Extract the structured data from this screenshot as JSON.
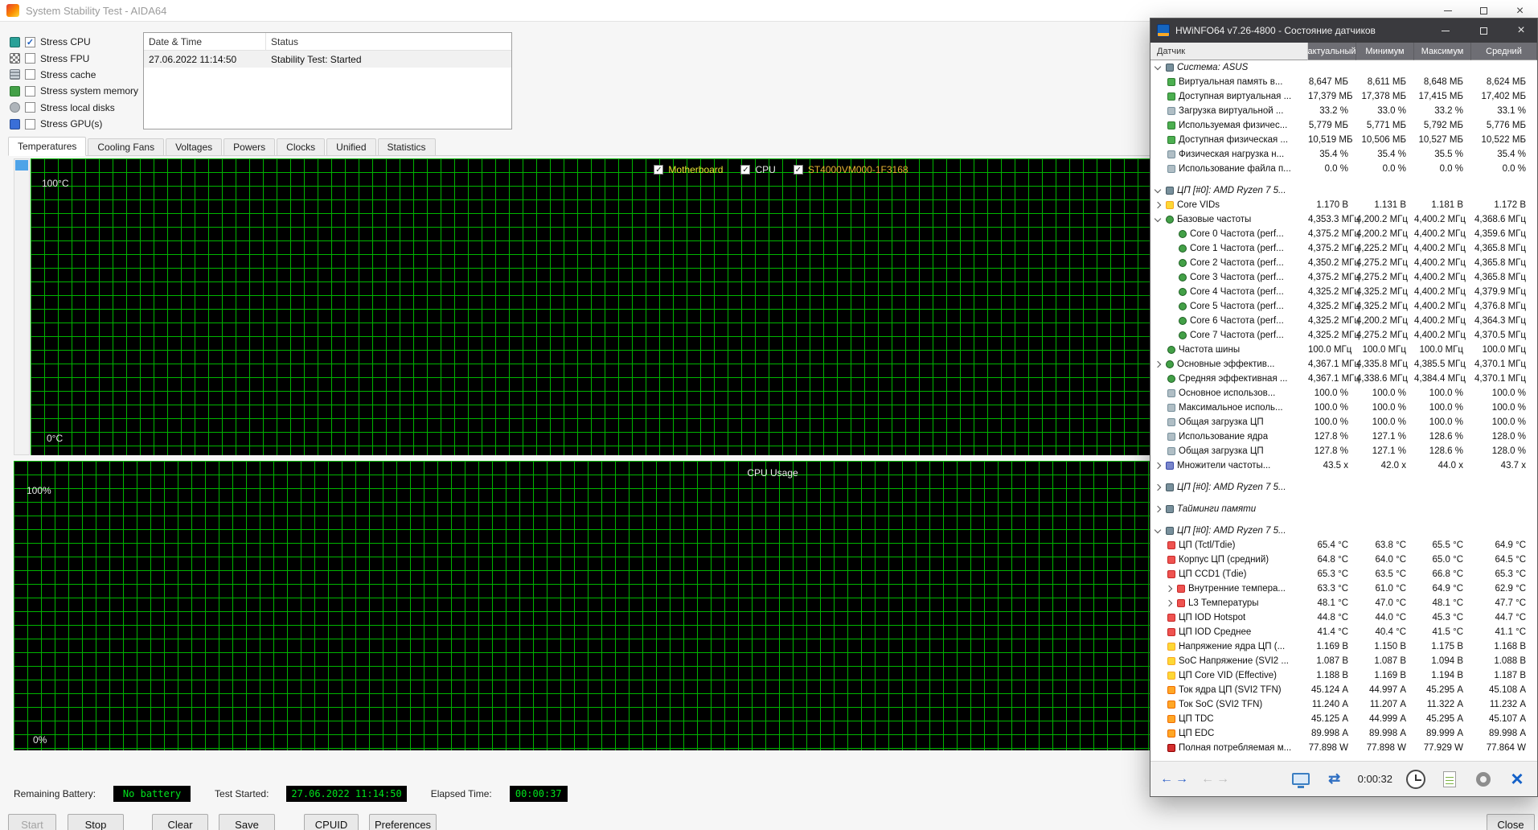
{
  "aida": {
    "window_title": "System Stability Test - AIDA64",
    "stress_options": [
      {
        "label": "Stress CPU",
        "checked": true,
        "icon": "cpu-icon"
      },
      {
        "label": "Stress FPU",
        "checked": false,
        "icon": "fpu-icon"
      },
      {
        "label": "Stress cache",
        "checked": false,
        "icon": "cache-icon"
      },
      {
        "label": "Stress system memory",
        "checked": false,
        "icon": "ram-icon"
      },
      {
        "label": "Stress local disks",
        "checked": false,
        "icon": "disk-icon"
      },
      {
        "label": "Stress GPU(s)",
        "checked": false,
        "icon": "gpu-icon"
      }
    ],
    "log_table": {
      "columns": [
        "Date & Time",
        "Status"
      ],
      "rows": [
        {
          "datetime": "27.06.2022 11:14:50",
          "status": "Stability Test: Started"
        }
      ]
    },
    "tabs": [
      {
        "label": "Temperatures",
        "active": true
      },
      {
        "label": "Cooling Fans",
        "active": false
      },
      {
        "label": "Voltages",
        "active": false
      },
      {
        "label": "Powers",
        "active": false
      },
      {
        "label": "Clocks",
        "active": false
      },
      {
        "label": "Unified",
        "active": false
      },
      {
        "label": "Statistics",
        "active": false
      }
    ],
    "temperature_chart": {
      "legend": [
        {
          "label": "Motherboard",
          "color": "#e8e832",
          "checked": true
        },
        {
          "label": "CPU",
          "color": "#e8e8e8",
          "checked": true
        },
        {
          "label": "ST4000VM000-1F3168",
          "color": "#e8b432",
          "checked": true
        }
      ],
      "y_top": "100°C",
      "y_bottom": "0°C"
    },
    "usage_chart": {
      "title": "CPU Usage",
      "y_top": "100%",
      "y_bottom": "0%"
    },
    "status_bar": [
      {
        "label": "Remaining Battery:",
        "value": "No battery"
      },
      {
        "label": "Test Started:",
        "value": "27.06.2022 11:14:50"
      },
      {
        "label": "Elapsed Time:",
        "value": "00:00:37"
      }
    ],
    "buttons": [
      {
        "label": "Start",
        "enabled": false
      },
      {
        "label": "Stop",
        "enabled": true
      },
      {
        "label": "Clear",
        "enabled": true
      },
      {
        "label": "Save",
        "enabled": true
      },
      {
        "label": "CPUID",
        "enabled": true
      },
      {
        "label": "Preferences",
        "enabled": true
      }
    ],
    "close_button": "Close"
  },
  "hwinfo": {
    "window_title": "HWiNFO64 v7.26-4800 - Состояние датчиков",
    "columns": [
      "Датчик",
      "актуальный",
      "Минимум",
      "Максимум",
      "Средний"
    ],
    "toolbar": {
      "timer": "0:00:32"
    },
    "rows": [
      {
        "t": "group",
        "chevron": "expanded",
        "label": "Система: ASUS"
      },
      {
        "t": "sensor",
        "icon": "memory-icon",
        "label": "Виртуальная память в...",
        "values": [
          "8,647 МБ",
          "8,611 МБ",
          "8,648 МБ",
          "8,624 МБ"
        ]
      },
      {
        "t": "sensor",
        "icon": "memory-icon",
        "label": "Доступная виртуальная ...",
        "values": [
          "17,379 МБ",
          "17,378 МБ",
          "17,415 МБ",
          "17,402 МБ"
        ]
      },
      {
        "t": "sensor",
        "icon": "usage-icon",
        "label": "Загрузка виртуальной ...",
        "values": [
          "33.2 %",
          "33.0 %",
          "33.2 %",
          "33.1 %"
        ]
      },
      {
        "t": "sensor",
        "icon": "memory-icon",
        "label": "Используемая физичес...",
        "values": [
          "5,779 МБ",
          "5,771 МБ",
          "5,792 МБ",
          "5,776 МБ"
        ]
      },
      {
        "t": "sensor",
        "icon": "memory-icon",
        "label": "Доступная физическая ...",
        "values": [
          "10,519 МБ",
          "10,506 МБ",
          "10,527 МБ",
          "10,522 МБ"
        ]
      },
      {
        "t": "sensor",
        "icon": "usage-icon",
        "label": "Физическая нагрузка н...",
        "values": [
          "35.4 %",
          "35.4 %",
          "35.5 %",
          "35.4 %"
        ]
      },
      {
        "t": "sensor",
        "icon": "usage-icon",
        "label": "Использование файла п...",
        "values": [
          "0.0 %",
          "0.0 %",
          "0.0 %",
          "0.0 %"
        ]
      },
      {
        "t": "gap"
      },
      {
        "t": "group",
        "chevron": "expanded",
        "label": "ЦП [#0]: AMD Ryzen 7 5..."
      },
      {
        "t": "sensor",
        "icon": "voltage-icon",
        "chevron": "collapsed",
        "label": "Core VIDs",
        "values": [
          "1.170 В",
          "1.131 В",
          "1.181 В",
          "1.172 В"
        ]
      },
      {
        "t": "sensor",
        "icon": "clock-icon",
        "chevron": "expanded",
        "label": "Базовые частоты",
        "values": [
          "4,353.3 МГц",
          "4,200.2 МГц",
          "4,400.2 МГц",
          "4,368.6 МГц"
        ]
      },
      {
        "t": "sensor",
        "icon": "clock-icon",
        "indent": 1,
        "label": "Core 0 Частота (perf...",
        "values": [
          "4,375.2 МГц",
          "4,200.2 МГц",
          "4,400.2 МГц",
          "4,359.6 МГц"
        ]
      },
      {
        "t": "sensor",
        "icon": "clock-icon",
        "indent": 1,
        "label": "Core 1 Частота (perf...",
        "values": [
          "4,375.2 МГц",
          "4,225.2 МГц",
          "4,400.2 МГц",
          "4,365.8 МГц"
        ]
      },
      {
        "t": "sensor",
        "icon": "clock-icon",
        "indent": 1,
        "label": "Core 2 Частота (perf...",
        "values": [
          "4,350.2 МГц",
          "4,275.2 МГц",
          "4,400.2 МГц",
          "4,365.8 МГц"
        ]
      },
      {
        "t": "sensor",
        "icon": "clock-icon",
        "indent": 1,
        "label": "Core 3 Частота (perf...",
        "values": [
          "4,375.2 МГц",
          "4,275.2 МГц",
          "4,400.2 МГц",
          "4,365.8 МГц"
        ]
      },
      {
        "t": "sensor",
        "icon": "clock-icon",
        "indent": 1,
        "label": "Core 4 Частота (perf...",
        "values": [
          "4,325.2 МГц",
          "4,325.2 МГц",
          "4,400.2 МГц",
          "4,379.9 МГц"
        ]
      },
      {
        "t": "sensor",
        "icon": "clock-icon",
        "indent": 1,
        "label": "Core 5 Частота (perf...",
        "values": [
          "4,325.2 МГц",
          "4,325.2 МГц",
          "4,400.2 МГц",
          "4,376.8 МГц"
        ]
      },
      {
        "t": "sensor",
        "icon": "clock-icon",
        "indent": 1,
        "label": "Core 6 Частота (perf...",
        "values": [
          "4,325.2 МГц",
          "4,200.2 МГц",
          "4,400.2 МГц",
          "4,364.3 МГц"
        ]
      },
      {
        "t": "sensor",
        "icon": "clock-icon",
        "indent": 1,
        "label": "Core 7 Частота (perf...",
        "values": [
          "4,325.2 МГц",
          "4,275.2 МГц",
          "4,400.2 МГц",
          "4,370.5 МГц"
        ]
      },
      {
        "t": "sensor",
        "icon": "clock-icon",
        "label": "Частота шины",
        "values": [
          "100.0 МГц",
          "100.0 МГц",
          "100.0 МГц",
          "100.0 МГц"
        ]
      },
      {
        "t": "sensor",
        "icon": "clock-icon",
        "chevron": "collapsed",
        "label": "Основные эффектив...",
        "values": [
          "4,367.1 МГц",
          "4,335.8 МГц",
          "4,385.5 МГц",
          "4,370.1 МГц"
        ]
      },
      {
        "t": "sensor",
        "icon": "clock-icon",
        "label": "Средняя эффективная ...",
        "values": [
          "4,367.1 МГц",
          "4,338.6 МГц",
          "4,384.4 МГц",
          "4,370.1 МГц"
        ]
      },
      {
        "t": "sensor",
        "icon": "usage-icon",
        "label": "Основное использов...",
        "values": [
          "100.0 %",
          "100.0 %",
          "100.0 %",
          "100.0 %"
        ]
      },
      {
        "t": "sensor",
        "icon": "usage-icon",
        "label": "Максимальное исполь...",
        "values": [
          "100.0 %",
          "100.0 %",
          "100.0 %",
          "100.0 %"
        ]
      },
      {
        "t": "sensor",
        "icon": "usage-icon",
        "label": "Общая загрузка ЦП",
        "values": [
          "100.0 %",
          "100.0 %",
          "100.0 %",
          "100.0 %"
        ]
      },
      {
        "t": "sensor",
        "icon": "usage-icon",
        "label": "Использование ядра",
        "values": [
          "127.8 %",
          "127.1 %",
          "128.6 %",
          "128.0 %"
        ]
      },
      {
        "t": "sensor",
        "icon": "usage-icon",
        "label": "Общая загрузка ЦП",
        "values": [
          "127.8 %",
          "127.1 %",
          "128.6 %",
          "128.0 %"
        ]
      },
      {
        "t": "sensor",
        "icon": "ratio-icon",
        "chevron": "collapsed",
        "label": "Множители частоты...",
        "values": [
          "43.5 x",
          "42.0 x",
          "44.0 x",
          "43.7 x"
        ]
      },
      {
        "t": "gap"
      },
      {
        "t": "group",
        "chevron": "collapsed",
        "label": "ЦП [#0]: AMD Ryzen 7 5..."
      },
      {
        "t": "gap"
      },
      {
        "t": "group",
        "chevron": "collapsed",
        "label": "Тайминги памяти"
      },
      {
        "t": "gap"
      },
      {
        "t": "group",
        "chevron": "expanded",
        "label": "ЦП [#0]: AMD Ryzen 7 5..."
      },
      {
        "t": "sensor",
        "icon": "temp-icon",
        "label": "ЦП (Tctl/Tdie)",
        "values": [
          "65.4 °C",
          "63.8 °C",
          "65.5 °C",
          "64.9 °C"
        ]
      },
      {
        "t": "sensor",
        "icon": "temp-icon",
        "label": "Корпус ЦП (средний)",
        "values": [
          "64.8 °C",
          "64.0 °C",
          "65.0 °C",
          "64.5 °C"
        ]
      },
      {
        "t": "sensor",
        "icon": "temp-icon",
        "label": "ЦП CCD1 (Tdie)",
        "values": [
          "65.3 °C",
          "63.5 °C",
          "66.8 °C",
          "65.3 °C"
        ]
      },
      {
        "t": "sensor",
        "icon": "temp-icon",
        "indent": 1,
        "chevron": "collapsed",
        "label": "Внутренние темпера...",
        "values": [
          "63.3 °C",
          "61.0 °C",
          "64.9 °C",
          "62.9 °C"
        ]
      },
      {
        "t": "sensor",
        "icon": "temp-icon",
        "indent": 1,
        "chevron": "collapsed",
        "label": "L3 Температуры",
        "values": [
          "48.1 °C",
          "47.0 °C",
          "48.1 °C",
          "47.7 °C"
        ]
      },
      {
        "t": "sensor",
        "icon": "temp-icon",
        "label": "ЦП IOD Hotspot",
        "values": [
          "44.8 °C",
          "44.0 °C",
          "45.3 °C",
          "44.7 °C"
        ]
      },
      {
        "t": "sensor",
        "icon": "temp-icon",
        "label": "ЦП IOD Среднее",
        "values": [
          "41.4 °C",
          "40.4 °C",
          "41.5 °C",
          "41.1 °C"
        ]
      },
      {
        "t": "sensor",
        "icon": "voltage-icon",
        "label": "Напряжение ядра ЦП (...",
        "values": [
          "1.169 В",
          "1.150 В",
          "1.175 В",
          "1.168 В"
        ]
      },
      {
        "t": "sensor",
        "icon": "voltage-icon",
        "label": "SoC Напряжение (SVI2 ...",
        "values": [
          "1.087 В",
          "1.087 В",
          "1.094 В",
          "1.088 В"
        ]
      },
      {
        "t": "sensor",
        "icon": "voltage-icon",
        "label": "ЦП Core VID (Effective)",
        "values": [
          "1.188 В",
          "1.169 В",
          "1.194 В",
          "1.187 В"
        ]
      },
      {
        "t": "sensor",
        "icon": "current-icon",
        "label": "Ток ядра ЦП (SVI2 TFN)",
        "values": [
          "45.124 А",
          "44.997 А",
          "45.295 А",
          "45.108 А"
        ]
      },
      {
        "t": "sensor",
        "icon": "current-icon",
        "label": "Ток SoC (SVI2 TFN)",
        "values": [
          "11.240 А",
          "11.207 А",
          "11.322 А",
          "11.232 А"
        ]
      },
      {
        "t": "sensor",
        "icon": "current-icon",
        "label": "ЦП TDC",
        "values": [
          "45.125 А",
          "44.999 А",
          "45.295 А",
          "45.107 А"
        ]
      },
      {
        "t": "sensor",
        "icon": "current-icon",
        "label": "ЦП EDC",
        "values": [
          "89.998 А",
          "89.998 А",
          "89.999 А",
          "89.998 А"
        ]
      },
      {
        "t": "sensor",
        "icon": "power-icon",
        "label": "Полная потребляемая м...",
        "values": [
          "77.898 W",
          "77.898 W",
          "77.929 W",
          "77.864 W"
        ]
      }
    ]
  }
}
